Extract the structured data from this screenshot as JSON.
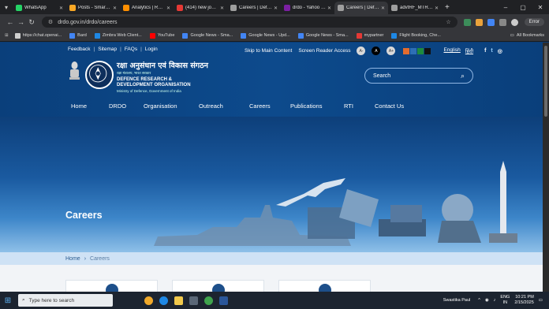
{
  "browser": {
    "tabs": [
      {
        "label": "WhatsApp",
        "color": "#25d366"
      },
      {
        "label": "Posts - Smart Up",
        "color": "#f9a825"
      },
      {
        "label": "Analytics | Realti",
        "color": "#ff8f00"
      },
      {
        "label": "(414) new job va",
        "color": "#e53935"
      },
      {
        "label": "Careers | Defen",
        "color": "#9e9e9e"
      },
      {
        "label": "drdo - Yahoo Se",
        "color": "#7b1fa2"
      },
      {
        "label": "Careers | Defen",
        "color": "#9e9e9e",
        "active": true
      },
      {
        "label": "advtRF_MTREC",
        "color": "#9e9e9e"
      }
    ],
    "url": "drdo.gov.in/drdo/careers",
    "error_label": "Error",
    "bookmarks": [
      {
        "label": "https://chat.openai...",
        "color": "#cfcfcf"
      },
      {
        "label": "Bard",
        "color": "#4285f4"
      },
      {
        "label": "Zimbra Web Client...",
        "color": "#1e88e5"
      },
      {
        "label": "YouTube",
        "color": "#ff0000"
      },
      {
        "label": "Google News - Sma...",
        "color": "#4285f4"
      },
      {
        "label": "Google News - Upd...",
        "color": "#4285f4"
      },
      {
        "label": "Google News - Sma...",
        "color": "#4285f4"
      },
      {
        "label": "mypartner",
        "color": "#e53935"
      },
      {
        "label": "Flight Booking, Che...",
        "color": "#1e88e5"
      }
    ],
    "all_bookmarks": "All Bookmarks"
  },
  "site": {
    "toplinks": [
      "Feedback",
      "Sitemap",
      "FAQs",
      "Login"
    ],
    "skip_main": "Skip to Main Content",
    "screen_reader": "Screen Reader Access",
    "font_buttons": [
      "A-",
      "A",
      "A+"
    ],
    "color_swatches": [
      "#e36c2e",
      "#2e6fb5",
      "#1e8a3e",
      "#111111"
    ],
    "lang_en": "English",
    "lang_hi": "हिंदी",
    "social": [
      {
        "icon": "facebook-icon",
        "glyph": "f",
        "color": "#1877f2"
      },
      {
        "icon": "twitter-icon",
        "glyph": "t",
        "color": "#1da1f2"
      },
      {
        "icon": "instagram-icon",
        "glyph": "◎",
        "color": "#e4405f"
      }
    ],
    "brand_hindi": "रक्षा अनुसंधान एवं विकास संगठन",
    "brand_hindi_sub": "रक्षा मंत्रालय, भारत सरकार",
    "brand_eng_1": "DEFENCE RESEARCH &",
    "brand_eng_2": "DEVELOPMENT ORGANISATION",
    "brand_ministry": "Ministry of Defence, Government of India",
    "search_placeholder": "Search",
    "nav": [
      "Home",
      "DRDO",
      "Organisation",
      "Outreach",
      "Careers",
      "Publications",
      "RTI",
      "Contact Us"
    ],
    "hero_title": "Careers",
    "breadcrumb": {
      "home": "Home",
      "current": "Careers"
    }
  },
  "taskbar": {
    "search_placeholder": "Type here to search",
    "user": "Swastika Paul",
    "lang": "ENG",
    "region": "IN",
    "time": "10:21 PM",
    "date": "2/15/2025"
  }
}
